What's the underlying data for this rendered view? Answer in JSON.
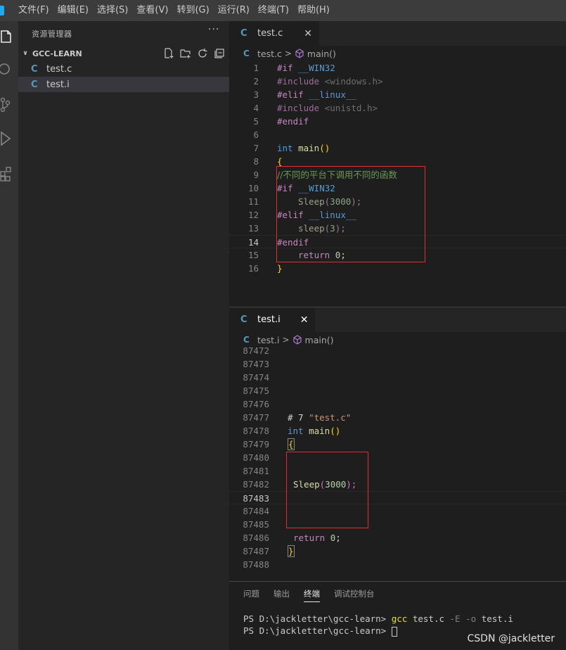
{
  "menu": [
    "文件(F)",
    "编辑(E)",
    "选择(S)",
    "查看(V)",
    "转到(G)",
    "运行(R)",
    "终端(T)",
    "帮助(H)"
  ],
  "sidebar": {
    "title": "资源管理器",
    "more": "···",
    "folder": "GCC-LEARN",
    "files": [
      {
        "icon": "C",
        "name": "test.c"
      },
      {
        "icon": "C",
        "name": "test.i"
      }
    ]
  },
  "editor1": {
    "tab": {
      "icon": "C",
      "name": "test.c",
      "close": "✕"
    },
    "breadcrumb": {
      "icon": "C",
      "file": "test.c",
      "sep": ">",
      "symbol": "main()"
    },
    "line_numbers": [
      "1",
      "2",
      "3",
      "4",
      "5",
      "6",
      "7",
      "8",
      "9",
      "10",
      "11",
      "12",
      "13",
      "14",
      "15",
      "16"
    ],
    "active_line": "14",
    "code": {
      "l1_a": "#if",
      "l1_b": "__WIN32",
      "l2_a": "#include",
      "l2_b": "<windows.h>",
      "l3_a": "#elif",
      "l3_b": "__linux__",
      "l4_a": "#include",
      "l4_b": "<unistd.h>",
      "l5_a": "#endif",
      "l7_a": "int",
      "l7_b": "main",
      "l7_c": "()",
      "l8_a": "{",
      "l9_a": "//不同的平台下调用不同的函数",
      "l10_a": "#if",
      "l10_b": "__WIN32",
      "l11_a": "Sleep",
      "l11_b": "(",
      "l11_c": "3000",
      "l11_d": ");",
      "l12_a": "#elif",
      "l12_b": "__linux__",
      "l13_a": "sleep",
      "l13_b": "(",
      "l13_c": "3",
      "l13_d": ");",
      "l14_a": "#endif",
      "l15_a": "return",
      "l15_b": "0",
      "l15_c": ";",
      "l16_a": "}"
    }
  },
  "editor2": {
    "tab": {
      "icon": "C",
      "name": "test.i",
      "close": "✕"
    },
    "breadcrumb": {
      "icon": "C",
      "file": "test.i",
      "sep": ">",
      "symbol": "main()"
    },
    "line_numbers": [
      "87472",
      "87473",
      "87474",
      "87475",
      "87476",
      "87477",
      "87478",
      "87479",
      "87480",
      "87481",
      "87482",
      "87483",
      "87484",
      "87485",
      "87486",
      "87487",
      "87488"
    ],
    "active_line": "87483",
    "code": {
      "l77_a": "# 7",
      "l77_b": "\"test.c\"",
      "l78_a": "int",
      "l78_b": "main",
      "l78_c": "()",
      "l79_a": "{",
      "l82_a": "Sleep",
      "l82_b": "(",
      "l82_c": "3000",
      "l82_d": ");",
      "l86_a": "return",
      "l86_b": "0",
      "l86_c": ";",
      "l87_a": "}"
    }
  },
  "panel": {
    "tabs": [
      "问题",
      "输出",
      "终端",
      "调试控制台"
    ],
    "active_tab": "终端",
    "terminal": [
      {
        "prompt": "PS D:\\jackletter\\gcc-learn>",
        "cmd": "gcc",
        "arg1": "test.c",
        "flag1": "-E",
        "flag2": "-o",
        "arg2": "test.i"
      },
      {
        "prompt": "PS D:\\jackletter\\gcc-learn>"
      }
    ]
  },
  "watermark": "CSDN @jackletter",
  "colors": {
    "accent": "#007acc",
    "c_icon": "#519aba",
    "highlight_box": "#e02d2d"
  }
}
